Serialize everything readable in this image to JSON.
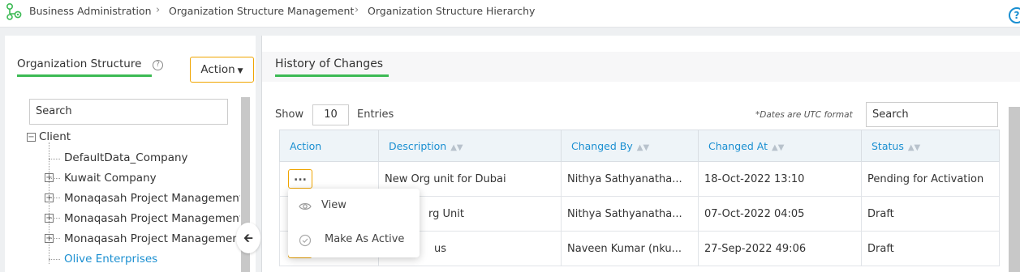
{
  "breadcrumb": {
    "items": [
      "Business Administration",
      "Organization Structure Management",
      "Organization Structure Hierarchy"
    ],
    "help": "?"
  },
  "left": {
    "title": "Organization Structure",
    "help": "?",
    "action_label": "Action",
    "search_placeholder": "Search",
    "tree": {
      "root": "Client",
      "items": [
        {
          "label": "DefaultData_Company",
          "expandable": false
        },
        {
          "label": "Kuwait Company",
          "expandable": true
        },
        {
          "label": "Monaqasah Project Management",
          "expandable": true
        },
        {
          "label": "Monaqasah Project Management",
          "expandable": true
        },
        {
          "label": "Monaqasah Project Management",
          "expandable": true
        },
        {
          "label": "Olive Enterprises",
          "expandable": false,
          "selected": true
        }
      ]
    },
    "collapse_icon": "arrow-left-icon"
  },
  "right": {
    "title": "History of Changes",
    "show_label": "Show",
    "entries_value": "10",
    "entries_label": "Entries",
    "utc_note": "*Dates are UTC format",
    "search_placeholder": "Search",
    "columns": [
      "Action",
      "Description",
      "Changed By",
      "Changed At",
      "Status"
    ],
    "rows": [
      {
        "description": "New Org unit for Dubai",
        "changed_by": "Nithya Sathyanatha...",
        "changed_at": "18-Oct-2022 13:10",
        "status": "Pending for Activation"
      },
      {
        "description": "rg Unit",
        "changed_by": "Nithya Sathyanatha...",
        "changed_at": "07-Oct-2022 04:05",
        "status": "Draft"
      },
      {
        "description": "us",
        "changed_by": "Naveen Kumar (nku...",
        "changed_at": "27-Sep-2022 49:06",
        "status": "Draft"
      }
    ],
    "row_menu_label": "...",
    "menu": [
      {
        "label": "View",
        "icon": "eye-icon"
      },
      {
        "label": "Make As Active",
        "icon": "check-circle-icon"
      }
    ]
  },
  "colors": {
    "accent": "#1a8fd1",
    "tab_underline": "#3cba54",
    "action_border": "#f0a500"
  }
}
